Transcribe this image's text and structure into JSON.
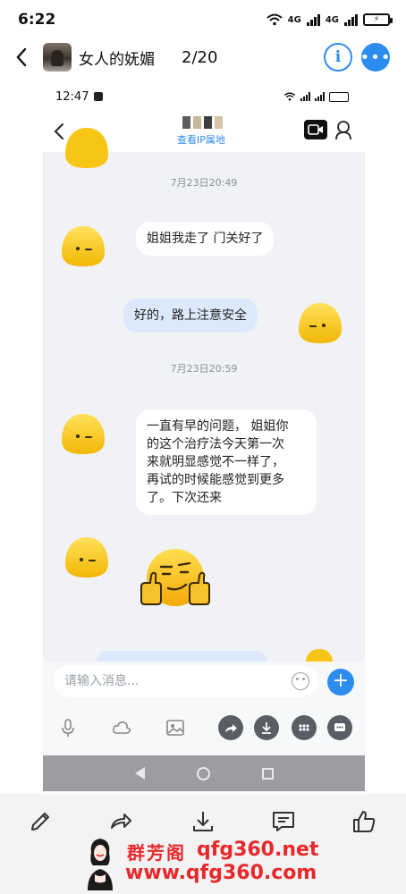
{
  "status_bar": {
    "time": "6:22",
    "network_1": "4G",
    "network_2": "4G"
  },
  "header": {
    "group_name": "女人的妩媚",
    "page_counter": "2/20"
  },
  "inner": {
    "status_time": "12:47",
    "ip_link": "查看IP属地",
    "messages": [
      {
        "type": "timestamp",
        "text": "7月23日20:49"
      },
      {
        "type": "incoming",
        "text": "姐姐我走了 门关好了"
      },
      {
        "type": "outgoing",
        "text": "好的，路上注意安全"
      },
      {
        "type": "timestamp",
        "text": "7月23日20:59"
      },
      {
        "type": "incoming",
        "lines": [
          "一直有早的问题， 姐姐你",
          "的这个治疗法今天第一次",
          "来就明显感觉不一样了，",
          "再试的时候能感觉到更多",
          "了。下次还来"
        ]
      },
      {
        "type": "incoming-emoji",
        "emoji": "thumbs-up-smirk"
      }
    ],
    "input_placeholder": "请输入消息..."
  },
  "watermark": {
    "brand_cn": "群芳阁",
    "domain": "qfg360.net",
    "url": "www.qfg360.com"
  },
  "colors": {
    "accent": "#2d8cf0",
    "bubble_out": "#dbe9fb",
    "watermark": "#e8282b"
  }
}
